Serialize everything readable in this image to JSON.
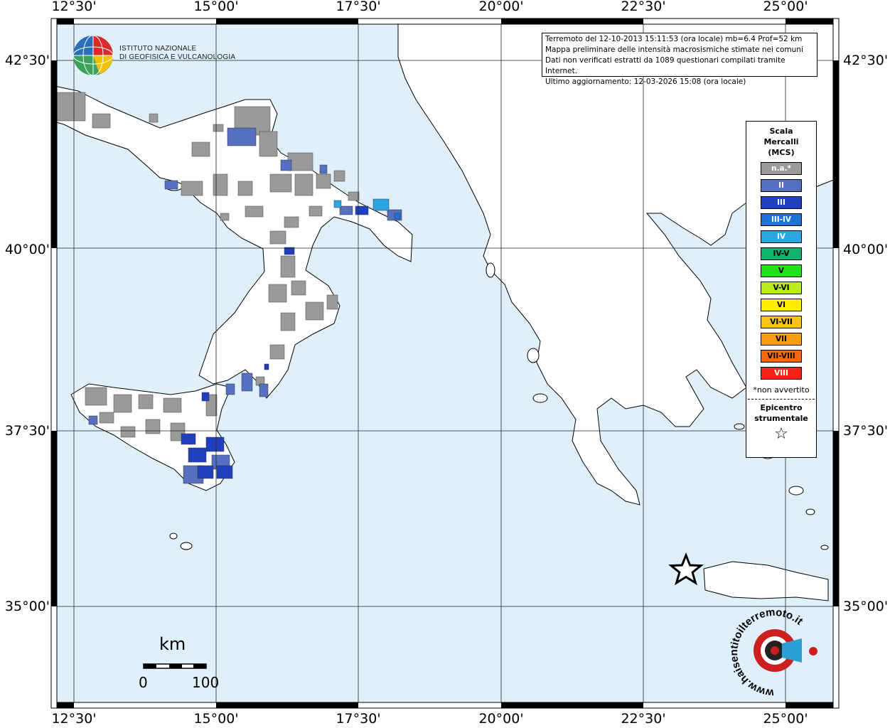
{
  "map": {
    "lon_ticks": [
      "12°30'",
      "15°00'",
      "17°30'",
      "20°00'",
      "22°30'",
      "25°00'"
    ],
    "lat_ticks": [
      "42°30'",
      "40°00'",
      "37°30'",
      "35°00'"
    ],
    "colors": {
      "sea": "#e0f0fb",
      "land": "#ffffff",
      "coast": "#000000",
      "na": "#9a9a9a",
      "II": "#5570c0",
      "III": "#1f3fbf"
    }
  },
  "infobox": {
    "line1": "Terremoto del 12-10-2013 15:11:53 (ora locale) mb=6.4 Prof=52 km",
    "line2": "Mappa preliminare delle intensità macrosismiche stimate nei comuni",
    "line3": "Dati non verificati estratti da 1089 questionari compilati tramite Internet.",
    "line4": "Ultimo aggiornamento: 12-03-2026 15:08 (ora locale)"
  },
  "logo": {
    "line1": "ISTITUTO NAZIONALE",
    "line2": "DI GEOFISICA E VULCANOLOGIA"
  },
  "legend": {
    "title1": "Scala",
    "title2": "Mercalli",
    "title3": "(MCS)",
    "classes": [
      {
        "label": "n.a.*",
        "color": "#9a9a9a"
      },
      {
        "label": "II",
        "color": "#5570c0"
      },
      {
        "label": "III",
        "color": "#1f3fbf"
      },
      {
        "label": "III-IV",
        "color": "#1e73d6"
      },
      {
        "label": "IV",
        "color": "#2ba6e3"
      },
      {
        "label": "IV-V",
        "color": "#10b36b"
      },
      {
        "label": "V",
        "color": "#22e01a"
      },
      {
        "label": "V-VI",
        "color": "#b7ec1e"
      },
      {
        "label": "VI",
        "color": "#ffee00"
      },
      {
        "label": "VI-VII",
        "color": "#fcc21a"
      },
      {
        "label": "VII",
        "color": "#fb9d12"
      },
      {
        "label": "VII-VIII",
        "color": "#fb6a0a"
      },
      {
        "label": "VIII",
        "color": "#f42414"
      }
    ],
    "note": "*non avvertito",
    "epi1": "Epicentro",
    "epi2": "strumentale",
    "epi_symbol": "☆"
  },
  "scalebar": {
    "unit": "km",
    "start": "0",
    "end": "100"
  },
  "hst": {
    "text": "www.haisentitoilterremoto.it"
  }
}
